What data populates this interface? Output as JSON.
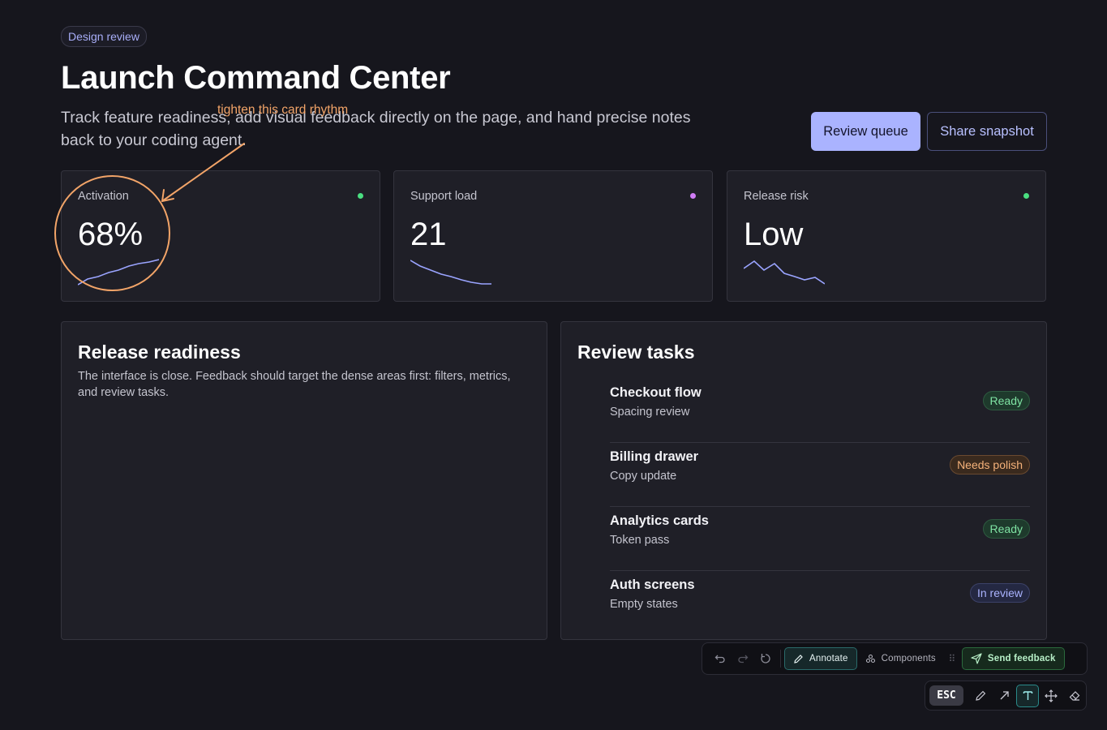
{
  "header": {
    "tag": "Design review",
    "title": "Launch Command Center",
    "subtitle": "Track feature readiness, add visual feedback directly on the page, and hand precise notes back to your coding agent.",
    "primary_button": "Review queue",
    "secondary_button": "Share snapshot"
  },
  "metrics": [
    {
      "label": "Activation",
      "value": "68%",
      "dot_color": "#4ade80",
      "spark_color": "#9aa4ff"
    },
    {
      "label": "Support load",
      "value": "21",
      "dot_color": "#d07cf5",
      "spark_color": "#9aa4ff"
    },
    {
      "label": "Release risk",
      "value": "Low",
      "dot_color": "#4ade80",
      "spark_color": "#9aa4ff"
    }
  ],
  "readiness": {
    "title": "Release readiness",
    "body": "The interface is close. Feedback should target the dense areas first: filters, metrics, and review tasks."
  },
  "review_tasks": {
    "title": "Review tasks",
    "items": [
      {
        "title": "Checkout flow",
        "subtitle": "Spacing review",
        "status": "Ready"
      },
      {
        "title": "Billing drawer",
        "subtitle": "Copy update",
        "status": "Needs polish"
      },
      {
        "title": "Analytics cards",
        "subtitle": "Token pass",
        "status": "Ready"
      },
      {
        "title": "Auth screens",
        "subtitle": "Empty states",
        "status": "In review"
      }
    ]
  },
  "annotation": {
    "note": "tighten this card rhythm",
    "color": "#f2a468"
  },
  "toolbar": {
    "annotate_label": "Annotate",
    "components_label": "Components",
    "send_label": "Send feedback",
    "esc_label": "ESC"
  },
  "icons": {
    "undo": "undo-icon",
    "redo": "redo-icon",
    "reset": "reset-icon",
    "pencil": "pencil-icon",
    "components": "components-icon",
    "drag": "drag-handle-icon",
    "send": "send-icon",
    "draw": "draw-icon",
    "arrow": "arrow-tool-icon",
    "text": "text-tool-icon",
    "move": "move-icon",
    "eraser": "eraser-icon"
  }
}
